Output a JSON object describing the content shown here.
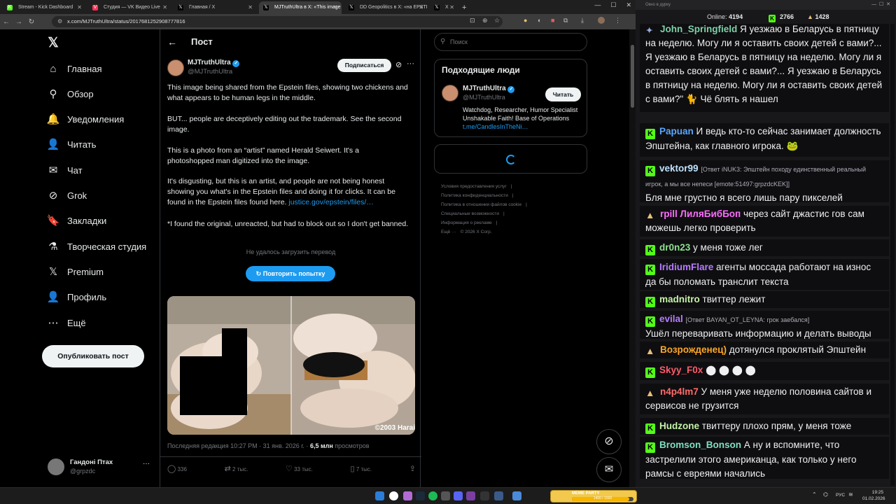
{
  "browser": {
    "tabs": [
      {
        "label": "Stream - Kick Dashboard",
        "fav": "K",
        "color": "#53fc18"
      },
      {
        "label": "Студия — VK Видео Live",
        "fav": "V",
        "color": "#ff3355"
      },
      {
        "label": "Главная / X",
        "fav": "𝕏",
        "color": "#000000"
      },
      {
        "label": "MJTruthUltra в X: «This image",
        "fav": "𝕏",
        "color": "#000000",
        "active": true
      },
      {
        "label": "DD Geopolitics в X: «на EPSTE",
        "fav": "𝕏",
        "color": "#000000"
      },
      {
        "label": "X",
        "fav": "𝕏",
        "color": "#000000"
      }
    ],
    "url": "x.com/MJTruthUltra/status/2017681252908777816"
  },
  "x": {
    "nav": [
      {
        "icon": "𝕏",
        "label": "",
        "name": "x-logo"
      },
      {
        "icon": "⌂",
        "label": "Главная",
        "name": "home"
      },
      {
        "icon": "⚲",
        "label": "Обзор",
        "name": "explore"
      },
      {
        "icon": "🔔",
        "label": "Уведомления",
        "name": "notifications"
      },
      {
        "icon": "👤",
        "label": "Читать",
        "name": "follow"
      },
      {
        "icon": "✉",
        "label": "Чат",
        "name": "chat"
      },
      {
        "icon": "⊘",
        "label": "Grok",
        "name": "grok"
      },
      {
        "icon": "🔖",
        "label": "Закладки",
        "name": "bookmarks"
      },
      {
        "icon": "⚗",
        "label": "Творческая студия",
        "name": "creator-studio"
      },
      {
        "icon": "𝕏",
        "label": "Premium",
        "name": "premium"
      },
      {
        "icon": "👤",
        "label": "Профиль",
        "name": "profile"
      },
      {
        "icon": "⋯",
        "label": "Ещё",
        "name": "more"
      }
    ],
    "post_button": "Опубликовать пост",
    "account": {
      "name": "Гандоні Птах",
      "handle": "@grpzdc"
    },
    "header_title": "Пост",
    "tweet": {
      "author": "MJTruthUltra",
      "handle": "@MJTruthUltra",
      "subscribe": "Подписаться",
      "p1": "This image being shared from the Epstein files, showing two chickens and what appears to be human legs in the middle.",
      "p2": "BUT... people are deceptively editing out the trademark. See the second image.",
      "p3": "This is a photo from an “artist” named Herald Seiwert. It's a photoshopped man digitized into the image.",
      "p4a": "It's disgusting, but this is an artist, and people are not being honest showing you what's in the Epstein files and doing it for clicks. It can be found in the Epstein files found here. ",
      "p4link": "justice.gov/epstein/files/…",
      "p5": "*I found the original, unreacted, but had to block out so I don't get banned.",
      "translate_fail": "Не удалось загрузить перевод",
      "retry": "Повторить попытку",
      "watermark": "©2003 Harai",
      "meta_prefix": "Последняя редакция 10:27 PM · 31 янв. 2026 г. · ",
      "views": "6,5 млн",
      "views_label": " просмотров",
      "replies": "336",
      "reposts": "2 тыс.",
      "likes": "33 тыс.",
      "bookmarks": "7 тыс."
    },
    "search_placeholder": "Поиск",
    "who_title": "Подходящие люди",
    "who": {
      "name": "MJTruthUltra",
      "handle": "@MJTruthUltra",
      "follow": "Читать",
      "bio": "Watchdog, Researcher, Humor Specialist Unshakable Faith! Base of Operations ",
      "bio_link": "t.me/CandlesInTheNi…"
    },
    "footer": [
      "Условия предоставления услуг",
      "|",
      "Политика конфиденциальности",
      "|",
      "Политика в отношении файлов cookie",
      "|",
      "Специальные возможности",
      "|",
      "Информация о рекламе",
      "|",
      "Ещё ···",
      "© 2026 X Corp."
    ]
  },
  "chat": {
    "window_title": "Окно в дурку",
    "online_label": "Online:",
    "online": "4194",
    "kick_count": "2766",
    "other_count": "1428",
    "messages": [
      {
        "user": "John_Springfield",
        "ucolor": "#7fd0a8",
        "badge": "star",
        "text": "Я уезжаю в Беларусь в пятницу на неделю. Могу ли я оставить своих детей с вами?... Я уезжаю в Беларусь в пятницу на неделю. Могу ли я оставить своих детей с вами?... Я уезжаю в Беларусь в пятницу на неделю. Могу ли я оставить своих детей с вами?\" 🐈 Чё блять я нашел"
      },
      {
        "user": "Papuan",
        "ucolor": "#59a6ff",
        "badge": "k",
        "text": "И ведь кто-то сейчас занимает должность Эпштейна, как главного игрока. 🐸"
      },
      {
        "user": "vektor99",
        "ucolor": "#bfe3ff",
        "badge": "k",
        "reply": "[Ответ iNUK3: Эпштейн походу единственный реальный игрок, а мы все непеси [emote:51497:grpzdcKEK]]",
        "text": "Бля мне грустно я всего лишь пару пикселей"
      },
      {
        "user": "rpill",
        "ucolor": "#ff6bff",
        "badge": "hat",
        "user2": "ЛиляБибБоп",
        "text": "через сайт джастис гов сам можешь легко проверить"
      },
      {
        "user": "dr0n23",
        "ucolor": "#8fe08f",
        "badge": "k",
        "text": "у меня тоже лег"
      },
      {
        "user": "IridiumFlare",
        "ucolor": "#b77cff",
        "badge": "k",
        "text": "агенты моссада работают на износ да бы поломать транслит текста"
      },
      {
        "user": "madnitro",
        "ucolor": "#c5f2a8",
        "badge": "k",
        "text": "твиттер лежит"
      },
      {
        "user": "evilal",
        "ucolor": "#b77cff",
        "badge": "k",
        "reply": "[Ответ BAYAN_OT_LEYNA: грок заебался]",
        "text": "Ушёл переваривать информацию и делать выводы"
      },
      {
        "user": "Возрожденец)",
        "ucolor": "#ffa726",
        "badge": "hat",
        "text": "дотянулся проклятый Эпштейн"
      },
      {
        "user": "Skyy_F0x",
        "ucolor": "#ff5b6b",
        "badge": "k",
        "text": "⬤ ⬤ ⬤ ⬤"
      },
      {
        "user": "n4p4lm7",
        "ucolor": "#ff6b6b",
        "badge": "hat",
        "text": "У меня уже неделю половина сайтов и сервисов не грузится"
      },
      {
        "user": "Hudzone",
        "ucolor": "#c5f2a8",
        "badge": "k",
        "text": "твиттеру плохо прям, у меня тоже"
      },
      {
        "user": "Bromson_Bonson",
        "ucolor": "#7fe0c0",
        "badge": "k",
        "text": "А ну и вспомните, что застрелили этого американца, как только у него рамсы с евреями начались"
      }
    ]
  },
  "taskbar": {
    "lang": "РУС",
    "time": "19:25",
    "date": "01.02.2026",
    "meme_label": "MEME PARTY",
    "meme_value": "1400 / 1500"
  }
}
